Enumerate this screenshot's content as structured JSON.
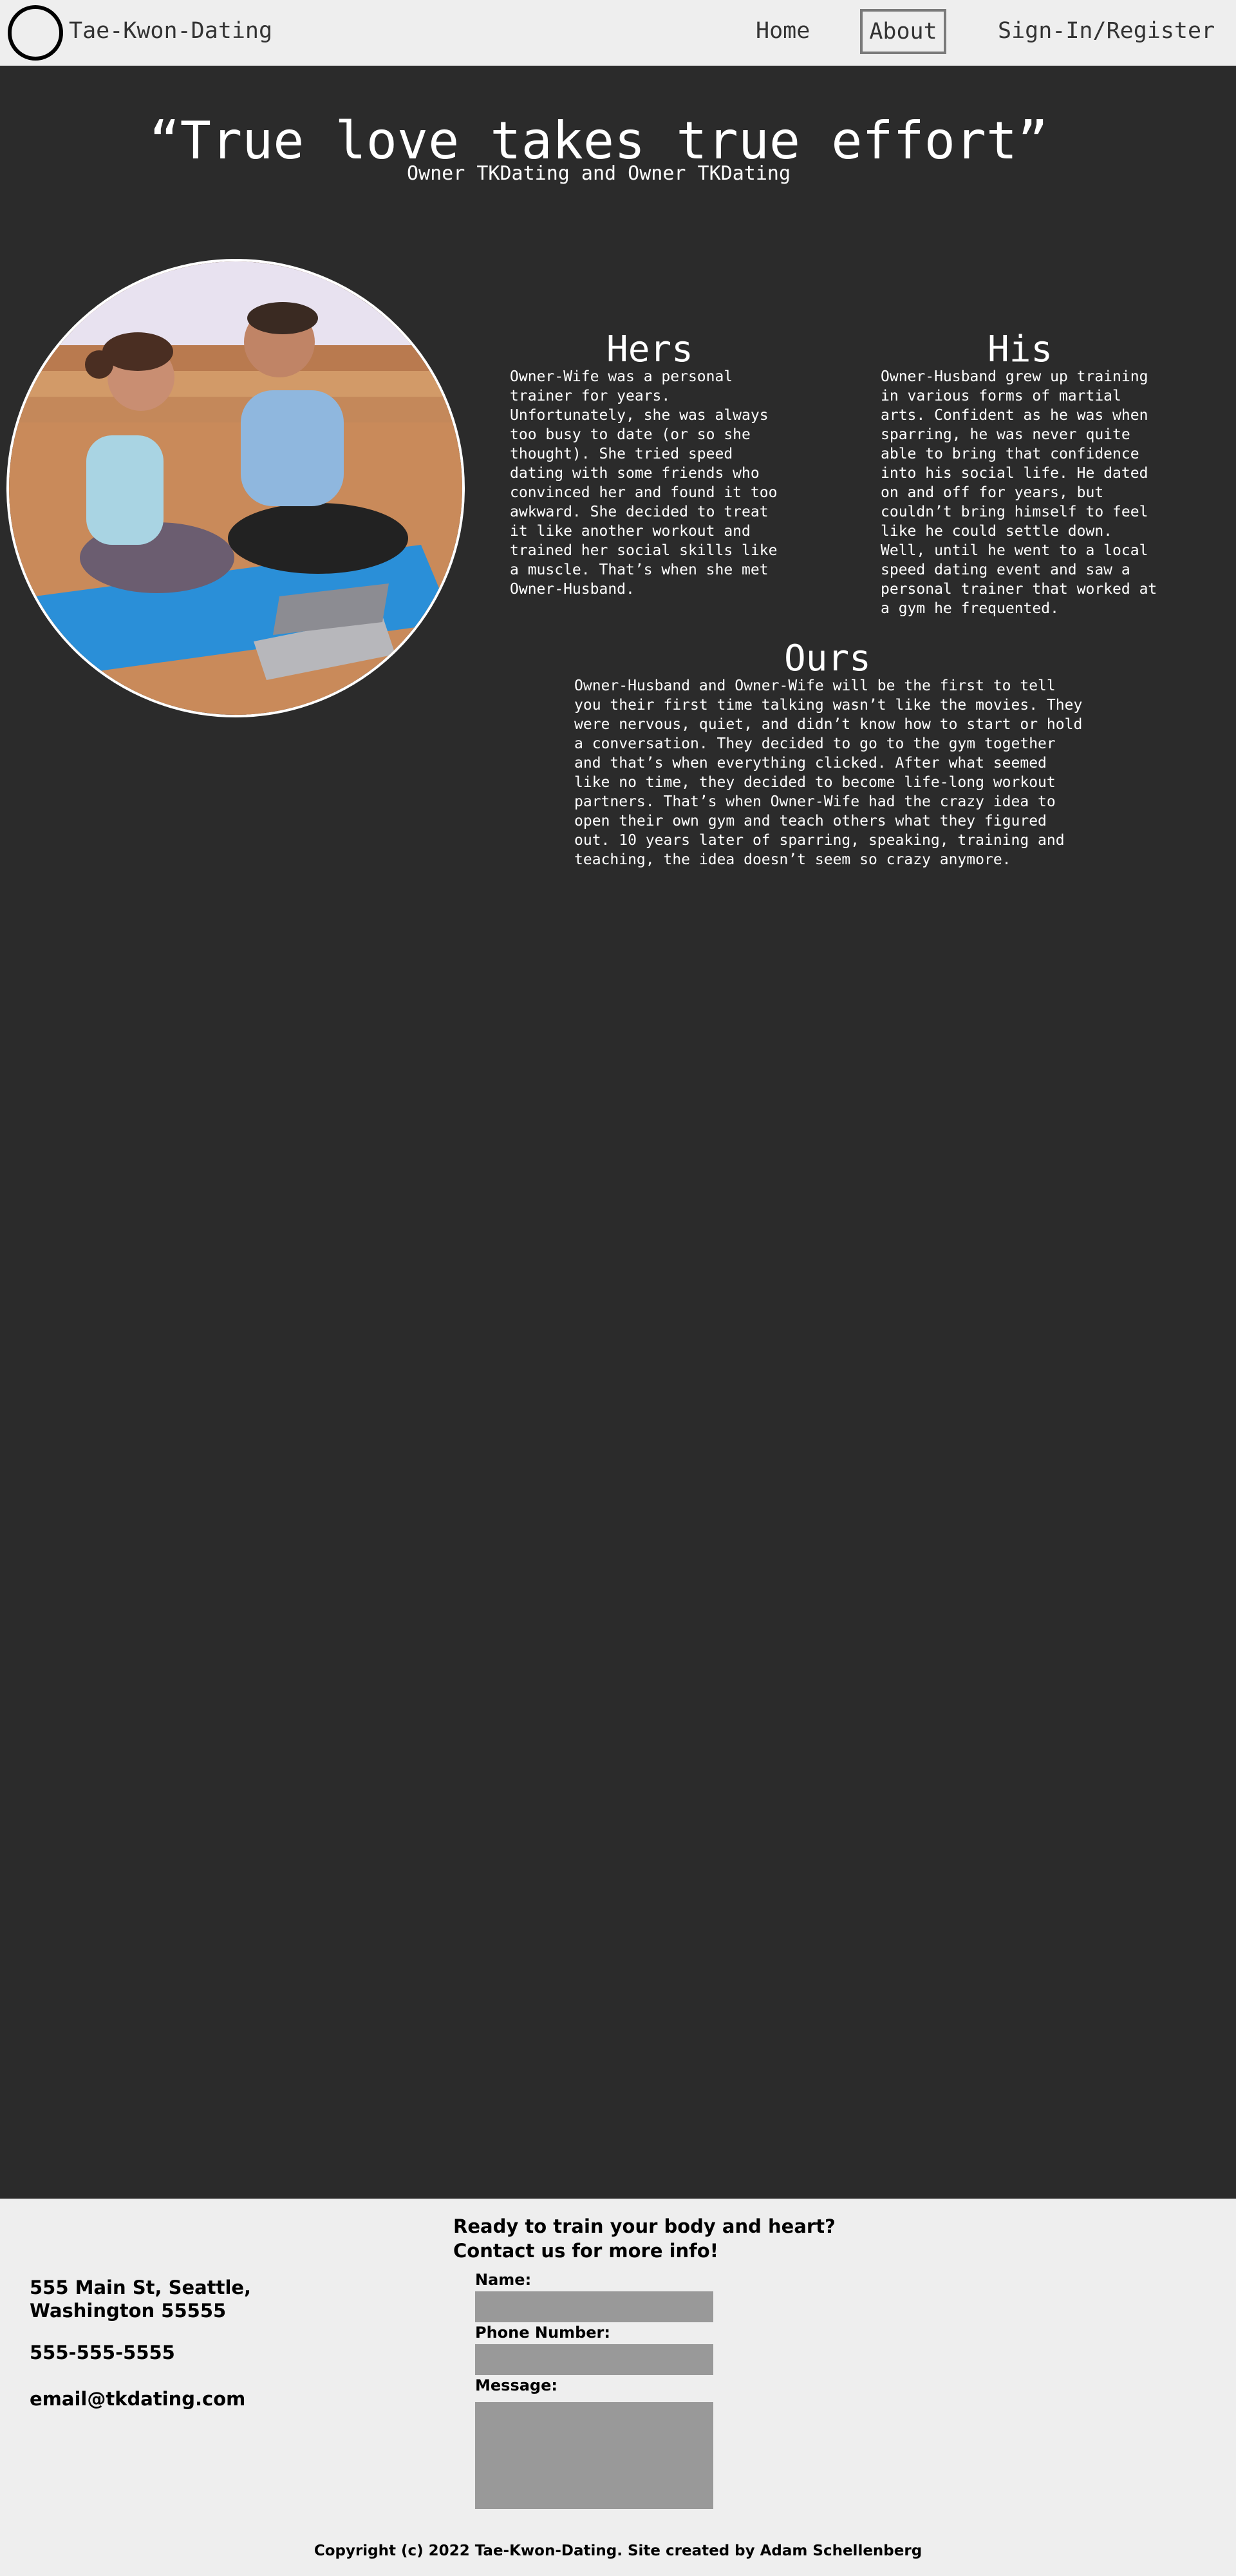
{
  "nav": {
    "brand": "Tae-Kwon-Dating",
    "links": [
      {
        "label": "Home"
      },
      {
        "label": "About"
      },
      {
        "label": "Sign-In/Register"
      }
    ]
  },
  "hero": {
    "quote": "“True love takes true effort”",
    "attribution": "Owner TKDating and Owner TKDating"
  },
  "story": {
    "hers": {
      "heading": "Hers",
      "text": "Owner-Wife was a personal trainer for years. Unfortunately, she was always too busy to date (or so she thought). She tried speed dating with some friends who convinced her and found it too awkward. She decided to treat it like another workout and trained her social skills like a muscle. That’s when she met Owner-Husband."
    },
    "his": {
      "heading": "His",
      "text": "Owner-Husband grew up training in various forms of martial arts. Confident as he was when sparring, he was never quite able to bring that confidence into his social life. He dated on and off for years, but couldn’t bring himself to feel like he could settle down. Well, until he went to a local speed dating event and saw a personal trainer that worked at a gym he frequented."
    },
    "ours": {
      "heading": "Ours",
      "text": "Owner-Husband and Owner-Wife will be the first to tell you their first time talking wasn’t like the movies. They were nervous, quiet, and didn’t know how to start or hold a conversation. They decided to go to the gym together and that’s when everything clicked. After what seemed like no time, they decided to become life-long workout partners. That’s when Owner-Wife had the crazy idea to open their own gym and teach others what they figured out. 10 years later of sparring, speaking, training and teaching, the idea doesn’t seem so crazy anymore."
    }
  },
  "footer": {
    "cta_line1": "Ready to train your body and heart?",
    "cta_line2": "Contact us for more info!",
    "address_line1": "555 Main St, Seattle,",
    "address_line2": "Washington 55555",
    "phone": "555-555-5555",
    "email": "email@tkdating.com",
    "form": {
      "name_label": "Name:",
      "name_value": "",
      "phone_label": "Phone Number:",
      "phone_value": "",
      "message_label": "Message:",
      "message_value": ""
    },
    "copyright": "Copyright (c) 2022 Tae-Kwon-Dating. Site created by Adam Schellenberg"
  },
  "colors": {
    "page_background": "#2b2b2b",
    "bar_background": "#eeeeee",
    "input_background": "#999999",
    "active_link_border": "#7a7a7a"
  },
  "icons": {
    "logo": "circle-logo-icon"
  }
}
